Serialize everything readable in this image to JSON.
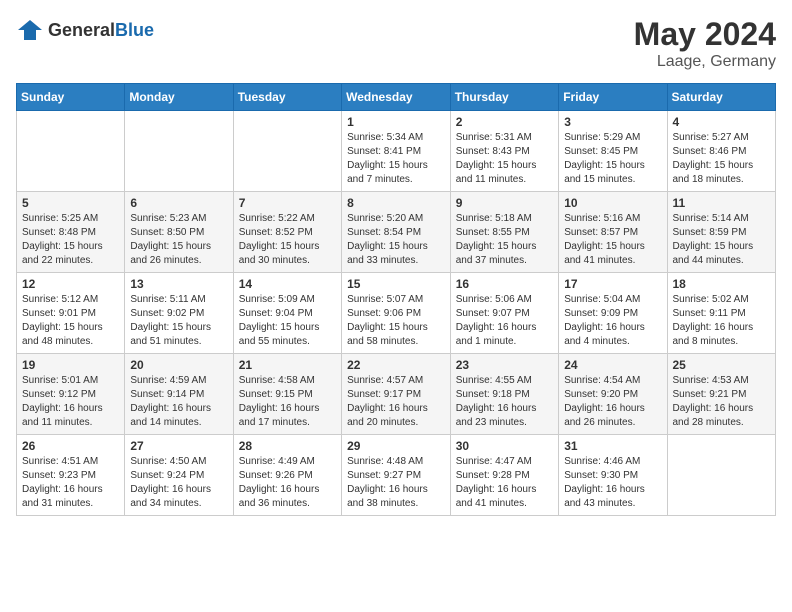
{
  "logo": {
    "general": "General",
    "blue": "Blue"
  },
  "title": {
    "month": "May 2024",
    "location": "Laage, Germany"
  },
  "headers": [
    "Sunday",
    "Monday",
    "Tuesday",
    "Wednesday",
    "Thursday",
    "Friday",
    "Saturday"
  ],
  "weeks": [
    [
      {
        "day": "",
        "info": ""
      },
      {
        "day": "",
        "info": ""
      },
      {
        "day": "",
        "info": ""
      },
      {
        "day": "1",
        "info": "Sunrise: 5:34 AM\nSunset: 8:41 PM\nDaylight: 15 hours\nand 7 minutes."
      },
      {
        "day": "2",
        "info": "Sunrise: 5:31 AM\nSunset: 8:43 PM\nDaylight: 15 hours\nand 11 minutes."
      },
      {
        "day": "3",
        "info": "Sunrise: 5:29 AM\nSunset: 8:45 PM\nDaylight: 15 hours\nand 15 minutes."
      },
      {
        "day": "4",
        "info": "Sunrise: 5:27 AM\nSunset: 8:46 PM\nDaylight: 15 hours\nand 18 minutes."
      }
    ],
    [
      {
        "day": "5",
        "info": "Sunrise: 5:25 AM\nSunset: 8:48 PM\nDaylight: 15 hours\nand 22 minutes."
      },
      {
        "day": "6",
        "info": "Sunrise: 5:23 AM\nSunset: 8:50 PM\nDaylight: 15 hours\nand 26 minutes."
      },
      {
        "day": "7",
        "info": "Sunrise: 5:22 AM\nSunset: 8:52 PM\nDaylight: 15 hours\nand 30 minutes."
      },
      {
        "day": "8",
        "info": "Sunrise: 5:20 AM\nSunset: 8:54 PM\nDaylight: 15 hours\nand 33 minutes."
      },
      {
        "day": "9",
        "info": "Sunrise: 5:18 AM\nSunset: 8:55 PM\nDaylight: 15 hours\nand 37 minutes."
      },
      {
        "day": "10",
        "info": "Sunrise: 5:16 AM\nSunset: 8:57 PM\nDaylight: 15 hours\nand 41 minutes."
      },
      {
        "day": "11",
        "info": "Sunrise: 5:14 AM\nSunset: 8:59 PM\nDaylight: 15 hours\nand 44 minutes."
      }
    ],
    [
      {
        "day": "12",
        "info": "Sunrise: 5:12 AM\nSunset: 9:01 PM\nDaylight: 15 hours\nand 48 minutes."
      },
      {
        "day": "13",
        "info": "Sunrise: 5:11 AM\nSunset: 9:02 PM\nDaylight: 15 hours\nand 51 minutes."
      },
      {
        "day": "14",
        "info": "Sunrise: 5:09 AM\nSunset: 9:04 PM\nDaylight: 15 hours\nand 55 minutes."
      },
      {
        "day": "15",
        "info": "Sunrise: 5:07 AM\nSunset: 9:06 PM\nDaylight: 15 hours\nand 58 minutes."
      },
      {
        "day": "16",
        "info": "Sunrise: 5:06 AM\nSunset: 9:07 PM\nDaylight: 16 hours\nand 1 minute."
      },
      {
        "day": "17",
        "info": "Sunrise: 5:04 AM\nSunset: 9:09 PM\nDaylight: 16 hours\nand 4 minutes."
      },
      {
        "day": "18",
        "info": "Sunrise: 5:02 AM\nSunset: 9:11 PM\nDaylight: 16 hours\nand 8 minutes."
      }
    ],
    [
      {
        "day": "19",
        "info": "Sunrise: 5:01 AM\nSunset: 9:12 PM\nDaylight: 16 hours\nand 11 minutes."
      },
      {
        "day": "20",
        "info": "Sunrise: 4:59 AM\nSunset: 9:14 PM\nDaylight: 16 hours\nand 14 minutes."
      },
      {
        "day": "21",
        "info": "Sunrise: 4:58 AM\nSunset: 9:15 PM\nDaylight: 16 hours\nand 17 minutes."
      },
      {
        "day": "22",
        "info": "Sunrise: 4:57 AM\nSunset: 9:17 PM\nDaylight: 16 hours\nand 20 minutes."
      },
      {
        "day": "23",
        "info": "Sunrise: 4:55 AM\nSunset: 9:18 PM\nDaylight: 16 hours\nand 23 minutes."
      },
      {
        "day": "24",
        "info": "Sunrise: 4:54 AM\nSunset: 9:20 PM\nDaylight: 16 hours\nand 26 minutes."
      },
      {
        "day": "25",
        "info": "Sunrise: 4:53 AM\nSunset: 9:21 PM\nDaylight: 16 hours\nand 28 minutes."
      }
    ],
    [
      {
        "day": "26",
        "info": "Sunrise: 4:51 AM\nSunset: 9:23 PM\nDaylight: 16 hours\nand 31 minutes."
      },
      {
        "day": "27",
        "info": "Sunrise: 4:50 AM\nSunset: 9:24 PM\nDaylight: 16 hours\nand 34 minutes."
      },
      {
        "day": "28",
        "info": "Sunrise: 4:49 AM\nSunset: 9:26 PM\nDaylight: 16 hours\nand 36 minutes."
      },
      {
        "day": "29",
        "info": "Sunrise: 4:48 AM\nSunset: 9:27 PM\nDaylight: 16 hours\nand 38 minutes."
      },
      {
        "day": "30",
        "info": "Sunrise: 4:47 AM\nSunset: 9:28 PM\nDaylight: 16 hours\nand 41 minutes."
      },
      {
        "day": "31",
        "info": "Sunrise: 4:46 AM\nSunset: 9:30 PM\nDaylight: 16 hours\nand 43 minutes."
      },
      {
        "day": "",
        "info": ""
      }
    ]
  ]
}
